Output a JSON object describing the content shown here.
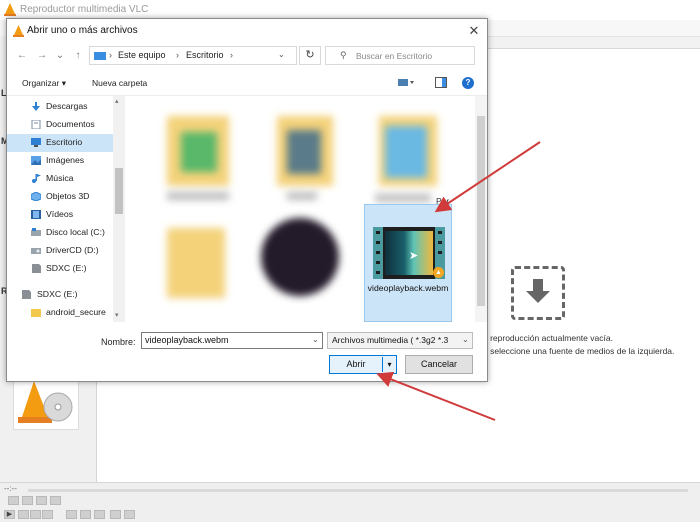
{
  "vlc": {
    "window_title": "Reproductor multimedia VLC",
    "empty_line1": "e reproducción actualmente vacía.",
    "empty_line2": "o seleccione una fuente de medios de la izquierda.",
    "time": "--:--"
  },
  "dialog": {
    "title": "Abrir uno o más archivos",
    "address": {
      "crumbs": [
        "Este equipo",
        "Escritorio"
      ]
    },
    "search_placeholder": "Buscar en Escritorio",
    "toolbar": {
      "organize": "Organizar",
      "new_folder": "Nueva carpeta"
    },
    "nav_items": [
      {
        "label": "Descargas",
        "icon": "download-icon"
      },
      {
        "label": "Documentos",
        "icon": "document-icon"
      },
      {
        "label": "Escritorio",
        "icon": "desktop-icon",
        "selected": true
      },
      {
        "label": "Imágenes",
        "icon": "pictures-icon"
      },
      {
        "label": "Música",
        "icon": "music-icon"
      },
      {
        "label": "Objetos 3D",
        "icon": "cube-icon"
      },
      {
        "label": "Vídeos",
        "icon": "video-icon"
      },
      {
        "label": "Disco local (C:)",
        "icon": "drive-icon"
      },
      {
        "label": "DriverCD (D:)",
        "icon": "cd-drive-icon"
      },
      {
        "label": "SDXC (E:)",
        "icon": "sd-card-icon"
      },
      {
        "label": "SDXC (E:)",
        "icon": "sd-card-icon"
      },
      {
        "label": "android_secure",
        "icon": "folder-icon"
      }
    ],
    "files": {
      "blurred_partial_label": "Por",
      "selected": {
        "name": "videoplayback.webm",
        "badge_icon": "vlc-cone-icon"
      }
    },
    "filename_label": "Nombre:",
    "filename_value": "videoplayback.webm",
    "filetype_value": "Archivos multimedia ( *.3g2 *.3",
    "open_label": "Abrir",
    "cancel_label": "Cancelar"
  },
  "colors": {
    "accent": "#0078d7",
    "selection": "#cce4f7",
    "annotation_arrow": "#d03a3a",
    "vlc_orange": "#f5a623"
  }
}
